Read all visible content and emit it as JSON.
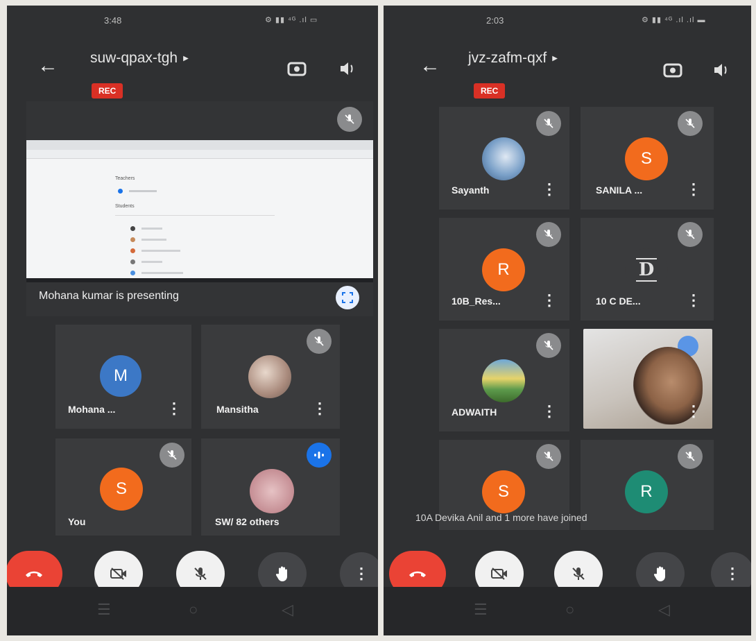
{
  "left": {
    "status_time": "3:48",
    "status_icons": "⚙ ▮▮ ⁴ᴳ .ıl ▭",
    "meeting_code": "suw-qpax-tgh",
    "rec": "REC",
    "presentation_caption": "Mohana kumar is presenting",
    "participants": [
      {
        "initial": "M",
        "name": "Mohana ...",
        "color": "#3c78c6"
      },
      {
        "initial": "",
        "name": "Mansitha",
        "color": "#b48c80"
      },
      {
        "initial": "S",
        "name": "You",
        "color": "#f26b1d"
      },
      {
        "initial": "",
        "name": "SW/  82 others",
        "color": "#c9a0a4"
      }
    ],
    "shared_screen": {
      "heading_teachers": "Teachers",
      "heading_students": "Students"
    }
  },
  "right": {
    "status_time": "2:03",
    "status_icons": "⚙ ▮▮ ⁴ᴳ .ıl .ıl ▬",
    "meeting_code": "jvz-zafm-qxf",
    "rec": "REC",
    "participants": [
      {
        "initial": "",
        "name": "Sayanth",
        "color": "#7aa0c8"
      },
      {
        "initial": "S",
        "name": "SANILA ...",
        "color": "#f26b1d"
      },
      {
        "initial": "R",
        "name": "10B_Res...",
        "color": "#f26b1d"
      },
      {
        "initial": "",
        "name": "10 C DE...",
        "color": "#3a3b3d"
      },
      {
        "initial": "",
        "name": "ADWAITH",
        "color": "#7fa36a"
      },
      {
        "initial": "S",
        "name": "",
        "color": "#f26b1d"
      },
      {
        "initial": "R",
        "name": "",
        "color": "#1e8c74"
      }
    ],
    "join_toast": "10A Devika Anil and 1 more have joined",
    "logo_text": "D"
  },
  "colors": {
    "end_call": "#ea4335",
    "rec": "#d93025",
    "background": "#2f3032"
  }
}
